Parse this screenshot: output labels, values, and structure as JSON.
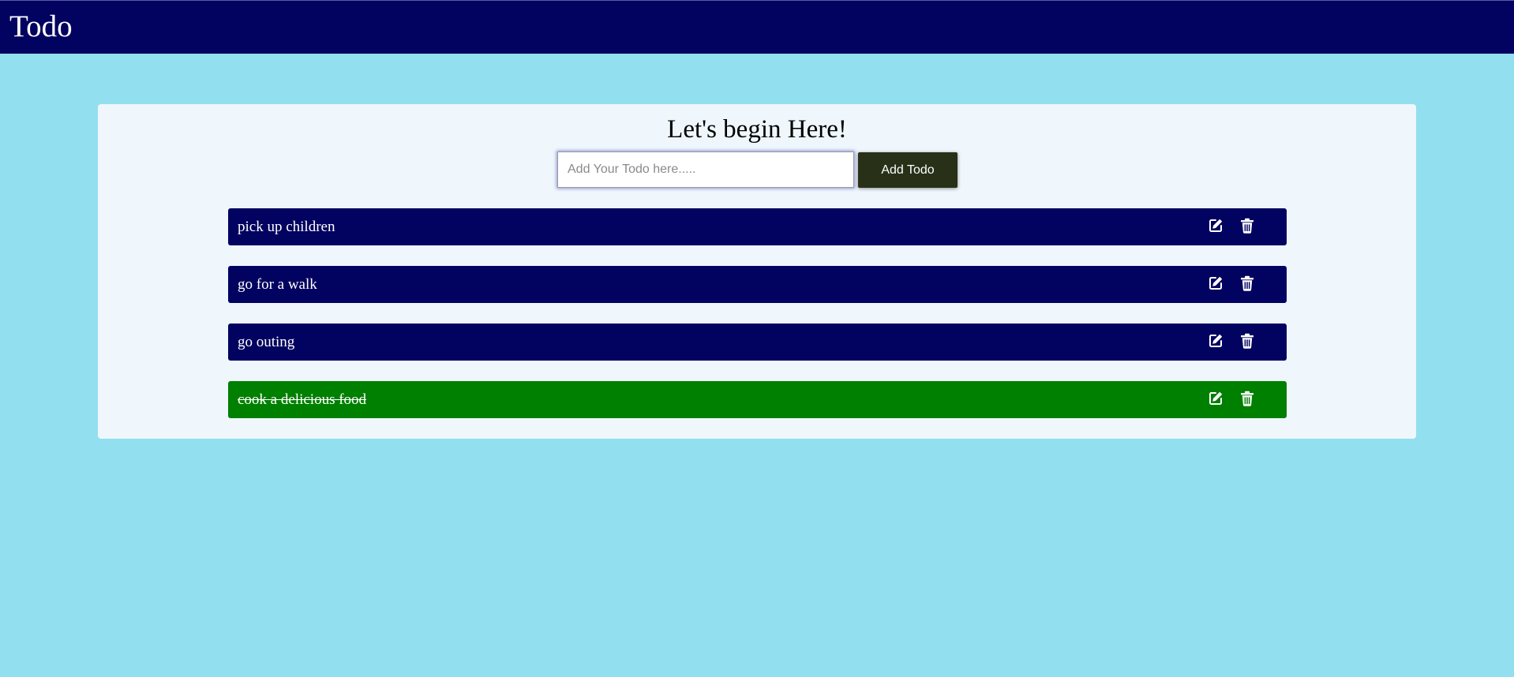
{
  "header": {
    "title": "Todo"
  },
  "main": {
    "heading": "Let's begin Here!",
    "input": {
      "placeholder": "Add Your Todo here.....",
      "value": ""
    },
    "add_button_label": "Add Todo",
    "todos": [
      {
        "text": "pick up children",
        "completed": false,
        "color": "#020260"
      },
      {
        "text": "go for a walk",
        "completed": false,
        "color": "#020260"
      },
      {
        "text": "go outing",
        "completed": false,
        "color": "#020260"
      },
      {
        "text": "cook a delicious food",
        "completed": true,
        "color": "#008000"
      }
    ],
    "item_icons": [
      "edit-icon",
      "trash-icon"
    ]
  },
  "colors": {
    "page_background": "#92dfef",
    "header_background": "#020260",
    "card_background": "#eff7fd",
    "item_background": "#020260",
    "completed_background": "#008000",
    "add_button_background": "#283118"
  }
}
